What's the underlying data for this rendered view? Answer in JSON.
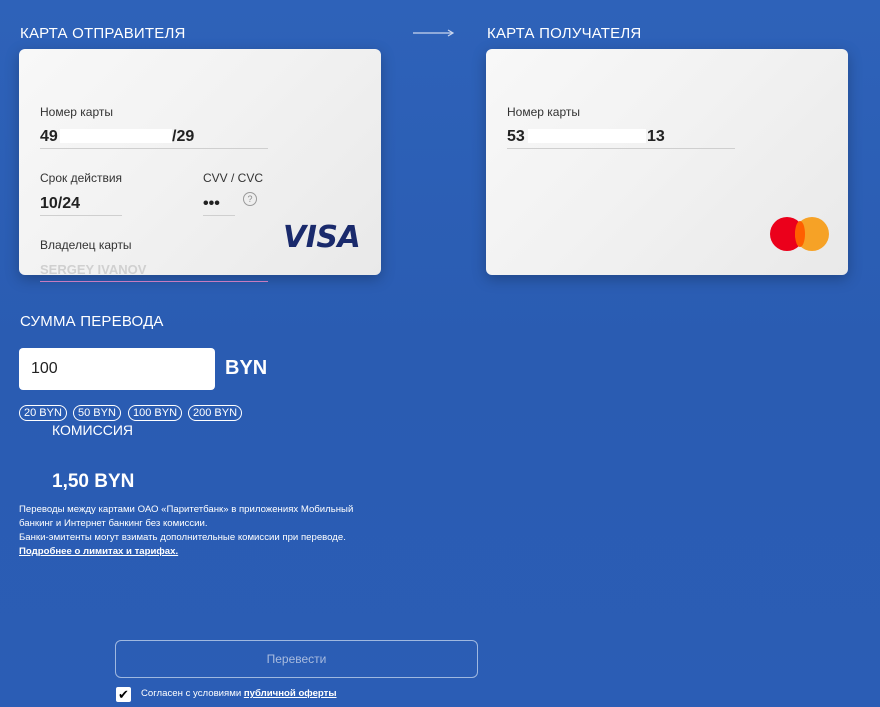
{
  "sender": {
    "title": "КАРТА ОТПРАВИТЕЛЯ",
    "card_number_label": "Номер карты",
    "card_number_prefix": "49",
    "card_number_suffix": "/29",
    "expiry_label": "Срок действия",
    "expiry_value": "10/24",
    "cvv_label": "CVV / CVC",
    "cvv_value": "•••",
    "cvv_help": "?",
    "owner_label": "Владелец карты",
    "owner_value": "SERGEY IVANOV",
    "brand": "VISA"
  },
  "arrow_icon": "arrow-right-icon",
  "recipient": {
    "title": "КАРТА ПОЛУЧАТЕЛЯ",
    "card_number_label": "Номер карты",
    "card_number_prefix": "53",
    "card_number_suffix": "13",
    "brand": "mastercard-logo"
  },
  "amount": {
    "title": "СУММА ПЕРЕВОДА",
    "value": "100",
    "currency": "BYN",
    "presets": [
      "20 BYN",
      "50 BYN",
      "100 BYN",
      "200 BYN"
    ]
  },
  "fee": {
    "label": "КОМИССИЯ",
    "value": "1,50 BYN"
  },
  "note": {
    "line1": "Переводы между картами ОАО «Паритетбанк» в приложениях Мобильный банкинг и Интернет банкинг без комиссии.",
    "line2": "Банки-эмитенты могут взимать дополнительные комиссии при переводе.",
    "link": "Подробнее о лимитах и тарифах."
  },
  "submit_label": "Перевести",
  "agreement": {
    "checked": true,
    "text": "Согласен с условиями ",
    "link": "публичной оферты"
  },
  "colors": {
    "background": "#2b5db5",
    "card": "#f2f2f2",
    "visa": "#1a2a6c",
    "mc_red": "#eb001b",
    "mc_yellow": "#f79e1b"
  }
}
